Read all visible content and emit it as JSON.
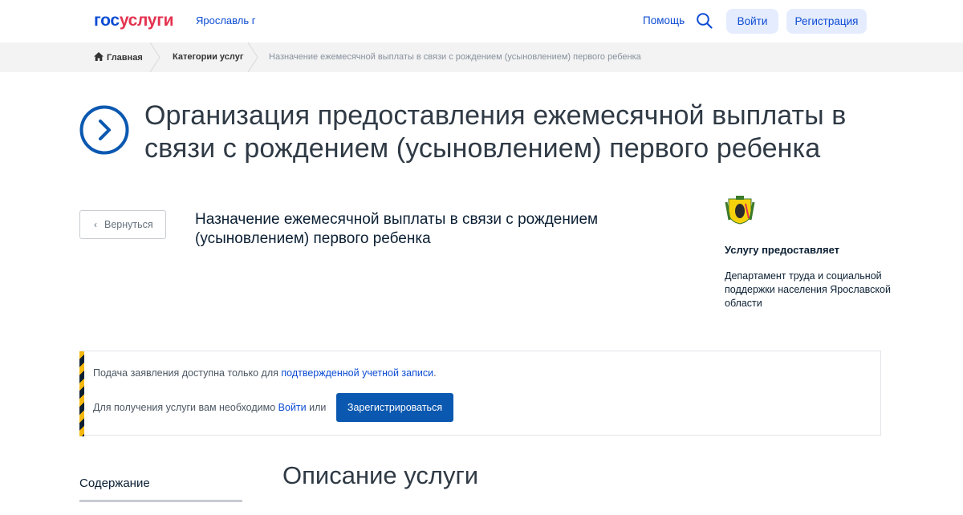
{
  "header": {
    "logo_part1": "гос",
    "logo_part2": "услуги",
    "region": "Ярославль г",
    "help": "Помощь",
    "login": "Войти",
    "register": "Регистрация",
    "search_icon": "search-icon"
  },
  "breadcrumbs": {
    "home": "Главная",
    "categories": "Категории услуг",
    "current": "Назначение ежемесячной выплаты в связи с рождением (усыновлением) первого ребенка"
  },
  "page": {
    "title": "Организация предоставления ежемесячной выплаты в связи с рождением (усыновлением) первого ребенка",
    "back": "Вернуться",
    "service_name": "Назначение ежемесячной выплаты в связи с рождением (усыновлением) первого ребенка"
  },
  "provider": {
    "label": "Услугу предоставляет",
    "name": "Департамент труда и социальной поддержки населения Ярославской области"
  },
  "notice": {
    "line1_text": "Подача заявления доступна только для ",
    "line1_link": "подтвержденной учетной записи",
    "line1_end": ".",
    "line2_text": "Для получения услуги вам необходимо ",
    "line2_link": "Войти",
    "line2_end": " или",
    "register_button": "Зарегистрироваться"
  },
  "content": {
    "toc_title": "Содержание",
    "section_title": "Описание услуги"
  },
  "colors": {
    "brand_blue": "#0d4cd3",
    "brand_red": "#e4324f",
    "primary_button": "#0b58b0",
    "stripe_yellow": "#f5b80c"
  }
}
